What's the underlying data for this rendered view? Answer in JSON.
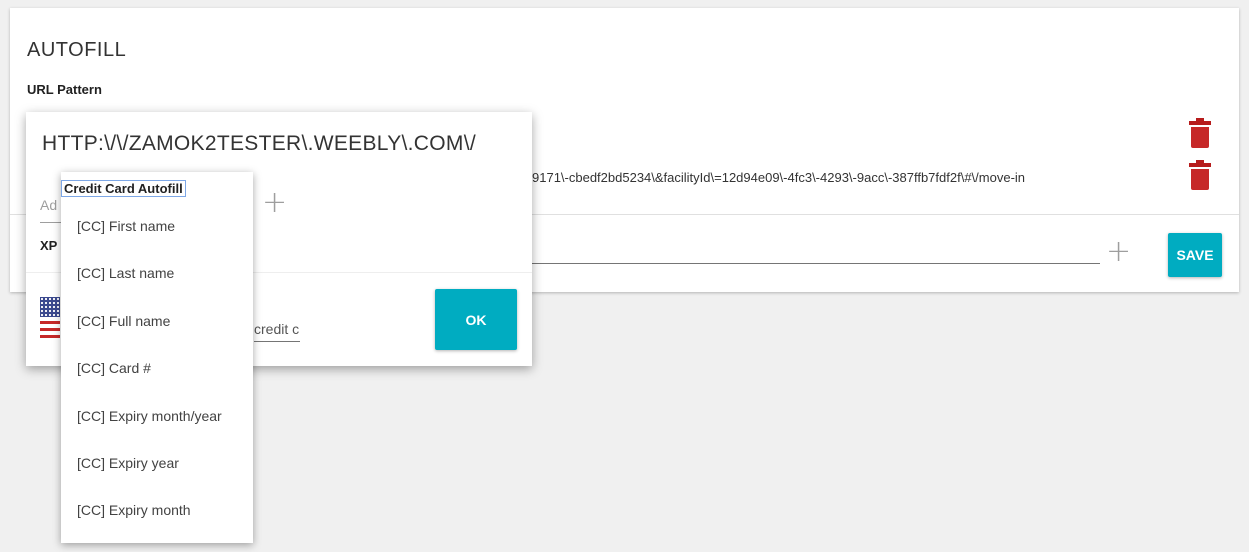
{
  "card": {
    "title": "AUTOFILL",
    "url_pattern_label": "URL Pattern",
    "url_row_visible_text": "9171\\-cbedf2bd5234\\&facilityId\\=12d94e09\\-4fc3\\-4293\\-9acc\\-387ffb7fdf2f\\#\\/move-in",
    "save_label": "SAVE",
    "delete_icon": "trash-icon",
    "add_icon": "plus-icon"
  },
  "dialog": {
    "url_pattern": "HTTP:\\/\\/ZAMOK2TESTER\\.WEEBLY\\.COM\\/",
    "add_input_fragment": "Ad",
    "xpath_fragment": "XP",
    "credit_field_fragment": "credit c",
    "ok_label": "OK",
    "flag_icon": "us-flag-icon"
  },
  "menu": {
    "header": "Credit Card Autofill",
    "items": [
      "[CC] First name",
      "[CC] Last name",
      "[CC] Full name",
      "[CC] Card #",
      "[CC] Expiry month/year",
      "[CC] Expiry year",
      "[CC] Expiry month"
    ]
  },
  "colors": {
    "accent": "#00acc1",
    "delete": "#c62828",
    "background": "#f0f0f0"
  }
}
